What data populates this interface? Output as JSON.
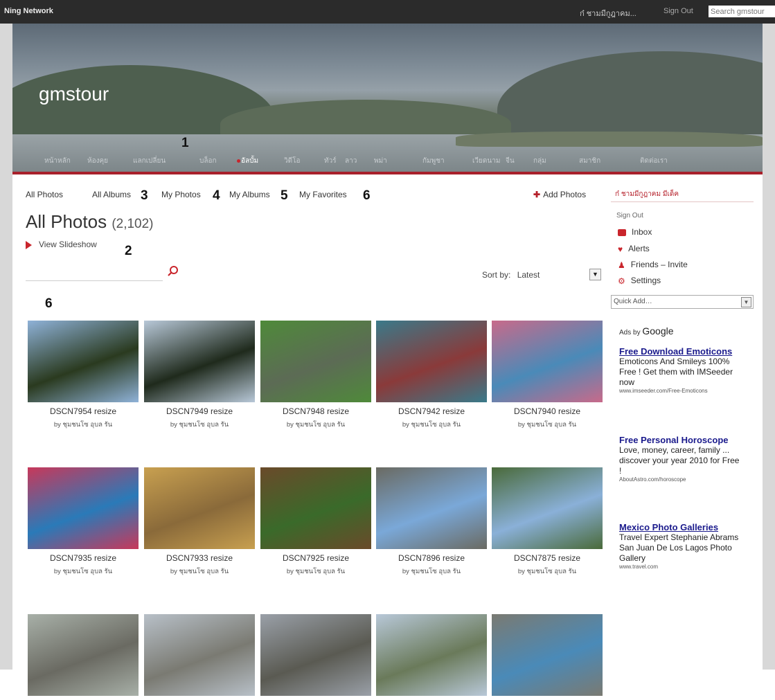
{
  "topbar": {
    "brand": "Ning Network",
    "user": "ก๋ ชามมีกูฎาคม...",
    "sign_out": "Sign Out",
    "search_placeholder": "Search gmstour"
  },
  "site_title": "gmstour",
  "nav_items": [
    "หน้าหลัก",
    "ห้องคุย",
    "แลกเปลี่ยน",
    "บล็อก",
    "อัลบั้ม",
    "วิดีโอ",
    "ทัวร์",
    "ลาว",
    "พม่า",
    "กัมพูชา",
    "เวียดนาม",
    "จีน",
    "กลุ่ม",
    "สมาชิก",
    "ติดต่อเรา"
  ],
  "nav_active": "อัลบั้ม",
  "tabs": [
    "All Photos",
    "All Albums",
    "My Photos",
    "My Albums",
    "My Favorites"
  ],
  "tab_numbers": [
    "3",
    "4",
    "5",
    "6"
  ],
  "annotations": {
    "nav": "1",
    "slideshow": "2",
    "grid": "6"
  },
  "add_photos": "Add Photos",
  "heading": "All Photos",
  "photo_count": "(2,102)",
  "view_slideshow": "View Slideshow",
  "sort": {
    "label": "Sort by:",
    "value": "Latest"
  },
  "photos": [
    {
      "title": "DSCN7954 resize",
      "by": "by ชุมชนโซ อุบล รัน"
    },
    {
      "title": "DSCN7949 resize",
      "by": "by ชุมชนโซ อุบล รัน"
    },
    {
      "title": "DSCN7948 resize",
      "by": "by ชุมชนโซ อุบล รัน"
    },
    {
      "title": "DSCN7942 resize",
      "by": "by ชุมชนโซ อุบล รัน"
    },
    {
      "title": "DSCN7940 resize",
      "by": "by ชุมชนโซ อุบล รัน"
    },
    {
      "title": "DSCN7935 resize",
      "by": "by ชุมชนโซ อุบล รัน"
    },
    {
      "title": "DSCN7933 resize",
      "by": "by ชุมชนโซ อุบล รัน"
    },
    {
      "title": "DSCN7925 resize",
      "by": "by ชุมชนโซ อุบล รัน"
    },
    {
      "title": "DSCN7896 resize",
      "by": "by ชุมชนโซ อุบล รัน"
    },
    {
      "title": "DSCN7875 resize",
      "by": "by ชุมชนโซ อุบล รัน"
    },
    {
      "title": "",
      "by": ""
    },
    {
      "title": "",
      "by": ""
    },
    {
      "title": "",
      "by": ""
    },
    {
      "title": "",
      "by": ""
    },
    {
      "title": "",
      "by": ""
    }
  ],
  "thumb_colors": [
    [
      "#2a3a1f",
      "#8fb2d8"
    ],
    [
      "#1f2a1c",
      "#b8c8d8"
    ],
    [
      "#5c6b55",
      "#4f8a3a"
    ],
    [
      "#8a3a3a",
      "#3a7a8a"
    ],
    [
      "#4a8ab8",
      "#c86a8a"
    ],
    [
      "#2a7ab8",
      "#c8385a"
    ],
    [
      "#8a6a3a",
      "#c8a050"
    ],
    [
      "#3a6a2a",
      "#6a4a2a"
    ],
    [
      "#7aa8d8",
      "#6a6a62"
    ],
    [
      "#8ab0d8",
      "#4a6a3a"
    ],
    [
      "#6a6a62",
      "#a8b0a8"
    ],
    [
      "#7a7a72",
      "#b8c0c8"
    ],
    [
      "#5a5a52",
      "#9aa0a8"
    ],
    [
      "#6a7a5a",
      "#b8c8d8"
    ],
    [
      "#4a8ab8",
      "#7a7a72"
    ]
  ],
  "sidebar": {
    "user": "ก๋ ชามมีกูฎาคม มีเด็ค",
    "sign_out": "Sign Out",
    "links": [
      "Inbox",
      "Alerts",
      "Friends – Invite",
      "Settings"
    ],
    "quick_add": "Quick Add…",
    "ads_by": "Ads by",
    "google": "Google",
    "ads": [
      {
        "title": "Free Download Emoticons",
        "body": "Emoticons And Smileys 100% Free ! Get them with IMSeeder now",
        "url": "www.imseeder.com/Free-Emoticons"
      },
      {
        "title": "Free Personal Horoscope",
        "body": "Love, money, career, family ... discover your year 2010 for Free !",
        "url": "AboutAstro.com/horoscope"
      },
      {
        "title": "Mexico Photo Galleries",
        "body": "Travel Expert Stephanie Abrams San Juan De Los Lagos Photo Gallery",
        "url": "www.travel.com"
      }
    ]
  },
  "colors": {
    "accent": "#b5202a",
    "topbar": "#2b2b2b"
  }
}
